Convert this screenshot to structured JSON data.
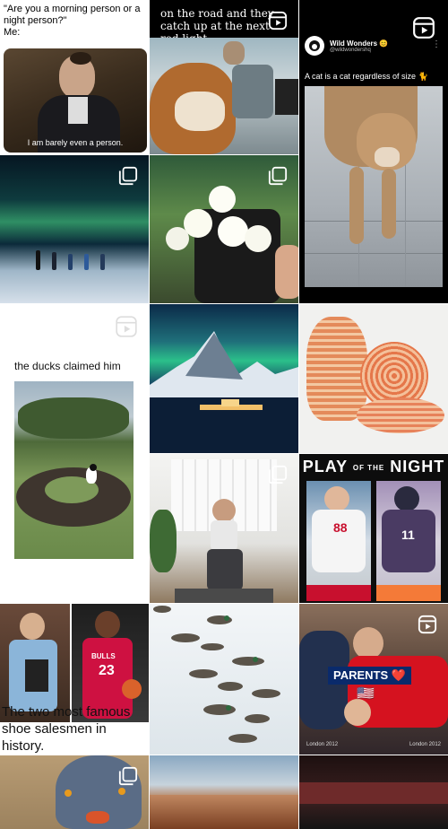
{
  "tiles": {
    "morning_meme": {
      "top_text": "\"Are you a morning person or a night person?\"",
      "me_text": "Me:",
      "subtitle": "I am barely even a person."
    },
    "road_meme": {
      "text": "on the road and they catch up at the next red light"
    },
    "wild_wonders": {
      "account_name": "Wild Wonders 😊",
      "handle": "@wildwondershq",
      "caption": "A cat is a cat regardless of size 🐈"
    },
    "ducks": {
      "caption": "the ducks claimed him"
    },
    "play_of_night": {
      "title_a": "PLAY",
      "title_b": "OF THE",
      "title_c": "NIGHT",
      "player_left_number": "88",
      "player_right_number": "11"
    },
    "shoe_meme": {
      "caption": "The two most famous shoe salesmen in history.",
      "jersey_text": "BULLS",
      "jersey_number": "23"
    },
    "parents": {
      "badge": "PARENTS ❤️",
      "flag": "🇺🇸",
      "london_left": "London 2012",
      "london_right": "London 2012"
    }
  }
}
